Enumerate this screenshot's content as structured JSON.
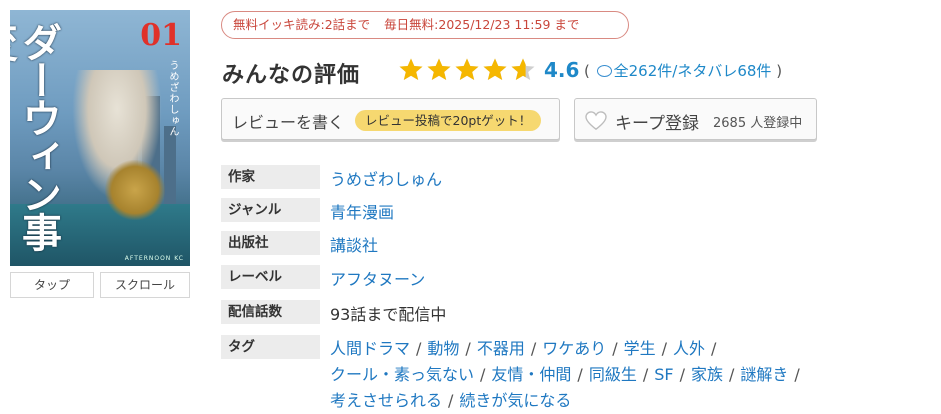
{
  "cover": {
    "title_vertical": "ダーウィン事変",
    "volume": "01",
    "author_vertical": "うめざわしゅん",
    "publisher_mark": "AFTERNOON KC",
    "tabs": [
      "タップ",
      "スクロール"
    ]
  },
  "free_badge": {
    "part1": "無料イッキ読み:2話まで",
    "part2": "毎日無料:2025/12/23 11:59 まで"
  },
  "rating": {
    "title": "みんなの評価",
    "score": "4.6",
    "score_value": 4.6,
    "open_paren": "(",
    "counts_link": "全262件/ネタバレ68件",
    "close_paren": ")"
  },
  "buttons": {
    "review_label": "レビューを書く",
    "review_pill": "レビュー投稿で20ptゲット！",
    "keep_label": "キープ登録",
    "keep_count": "2685 人登録中"
  },
  "info": {
    "author_label": "作家",
    "author": "うめざわしゅん",
    "genre_label": "ジャンル",
    "genre": "青年漫画",
    "publisher_label": "出版社",
    "publisher": "講談社",
    "label_label": "レーベル",
    "label": "アフタヌーン",
    "episodes_label": "配信話数",
    "episodes": "93話まで配信中",
    "tags_label": "タグ",
    "tags": [
      "人間ドラマ",
      "動物",
      "不器用",
      "ワケあり",
      "学生",
      "人外",
      "クール・素っ気ない",
      "友情・仲間",
      "同級生",
      "SF",
      "家族",
      "謎解き",
      "考えさせられる",
      "続きが気になる"
    ]
  },
  "colors": {
    "link": "#1f78c1",
    "score": "#1e88c8",
    "star": "#f5b700",
    "star_empty": "#cfcfcf",
    "badge": "#c9463b",
    "pill": "#f6d870"
  }
}
